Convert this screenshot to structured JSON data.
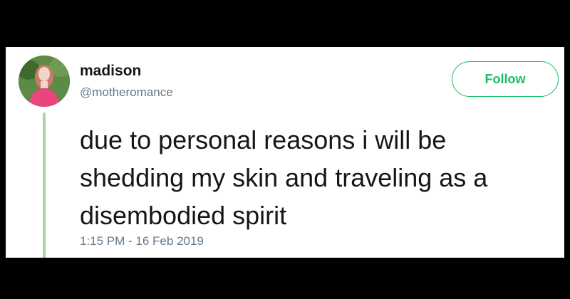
{
  "tweet": {
    "author": {
      "name": "madison",
      "handle": "@motheromance"
    },
    "follow_label": "Follow",
    "text_lines": [
      "due to personal reasons i will be",
      "shedding my skin and traveling as a",
      "disembodied spirit"
    ],
    "timestamp": "1:15 PM - 16 Feb 2019"
  },
  "colors": {
    "background": "#000000",
    "card": "#ffffff",
    "accent": "#17bf63",
    "thread_line": "#a3d89b",
    "text": "#14171a",
    "muted": "#657786"
  },
  "icons": {
    "avatar": "avatar-photo"
  }
}
